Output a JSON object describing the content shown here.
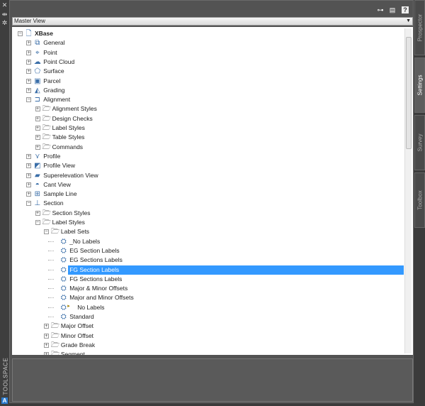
{
  "window": {
    "title": "TOOLSPACE",
    "logo": "A"
  },
  "toolbar": {
    "icons": [
      "network-icon",
      "panel-icon",
      "help-icon"
    ],
    "help_label": "?"
  },
  "view_select": {
    "value": "Master View"
  },
  "right_tabs": [
    {
      "label": "Prospector",
      "active": false
    },
    {
      "label": "Settings",
      "active": true
    },
    {
      "label": "Survey",
      "active": false
    },
    {
      "label": "Toolbox",
      "active": false
    }
  ],
  "tree": [
    {
      "label": "XBase",
      "level": 0,
      "state": "expanded",
      "icon": "drawing-icon",
      "bold": true
    },
    {
      "label": "General",
      "level": 1,
      "state": "collapsed",
      "icon": "general-icon"
    },
    {
      "label": "Point",
      "level": 1,
      "state": "collapsed",
      "icon": "point-icon"
    },
    {
      "label": "Point Cloud",
      "level": 1,
      "state": "collapsed",
      "icon": "point-cloud-icon"
    },
    {
      "label": "Surface",
      "level": 1,
      "state": "collapsed",
      "icon": "surface-icon"
    },
    {
      "label": "Parcel",
      "level": 1,
      "state": "collapsed",
      "icon": "parcel-icon"
    },
    {
      "label": "Grading",
      "level": 1,
      "state": "collapsed",
      "icon": "grading-icon"
    },
    {
      "label": "Alignment",
      "level": 1,
      "state": "expanded",
      "icon": "alignment-icon"
    },
    {
      "label": "Alignment Styles",
      "level": 2,
      "state": "collapsed",
      "icon": "folder-icon"
    },
    {
      "label": "Design Checks",
      "level": 2,
      "state": "collapsed",
      "icon": "folder-icon"
    },
    {
      "label": "Label Styles",
      "level": 2,
      "state": "collapsed",
      "icon": "folder-icon"
    },
    {
      "label": "Table Styles",
      "level": 2,
      "state": "collapsed",
      "icon": "folder-icon"
    },
    {
      "label": "Commands",
      "level": 2,
      "state": "collapsed",
      "icon": "folder-icon"
    },
    {
      "label": "Profile",
      "level": 1,
      "state": "collapsed",
      "icon": "profile-icon"
    },
    {
      "label": "Profile View",
      "level": 1,
      "state": "collapsed",
      "icon": "profile-view-icon"
    },
    {
      "label": "Superelevation View",
      "level": 1,
      "state": "collapsed",
      "icon": "superelevation-icon"
    },
    {
      "label": "Cant View",
      "level": 1,
      "state": "collapsed",
      "icon": "cant-icon"
    },
    {
      "label": "Sample Line",
      "level": 1,
      "state": "collapsed",
      "icon": "sample-line-icon"
    },
    {
      "label": "Section",
      "level": 1,
      "state": "expanded",
      "icon": "section-icon"
    },
    {
      "label": "Section Styles",
      "level": 2,
      "state": "collapsed",
      "icon": "folder-icon"
    },
    {
      "label": "Label Styles",
      "level": 2,
      "state": "expanded",
      "icon": "folder-open-icon"
    },
    {
      "label": "Label Sets",
      "level": 3,
      "state": "expanded",
      "icon": "folder-open-icon"
    },
    {
      "label": "_No Labels",
      "level": 4,
      "state": "leaf",
      "icon": "label-set-icon"
    },
    {
      "label": "EG Section Labels",
      "level": 4,
      "state": "leaf",
      "icon": "label-set-icon"
    },
    {
      "label": "EG Sections Labels",
      "level": 4,
      "state": "leaf",
      "icon": "label-set-icon"
    },
    {
      "label": "FG Section Labels",
      "level": 4,
      "state": "leaf",
      "icon": "label-set-icon",
      "selected": true
    },
    {
      "label": "FG Sections Labels",
      "level": 4,
      "state": "leaf",
      "icon": "label-set-icon"
    },
    {
      "label": "Major & Minor Offsets",
      "level": 4,
      "state": "leaf",
      "icon": "label-set-icon"
    },
    {
      "label": "Major and Minor Offsets",
      "level": 4,
      "state": "leaf",
      "icon": "label-set-icon"
    },
    {
      "label": "No Labels",
      "level": 4,
      "state": "leaf",
      "icon": "label-set-icon",
      "flagged": true
    },
    {
      "label": "Standard",
      "level": 4,
      "state": "leaf",
      "icon": "label-set-icon"
    },
    {
      "label": "Major Offset",
      "level": 3,
      "state": "collapsed",
      "icon": "folder-icon"
    },
    {
      "label": "Minor Offset",
      "level": 3,
      "state": "collapsed",
      "icon": "folder-icon"
    },
    {
      "label": "Grade Break",
      "level": 3,
      "state": "collapsed",
      "icon": "folder-icon"
    },
    {
      "label": "Segment",
      "level": 3,
      "state": "collapsed",
      "icon": "folder-icon"
    }
  ],
  "colors": {
    "selection": "#3399ff",
    "panel": "#535353"
  }
}
